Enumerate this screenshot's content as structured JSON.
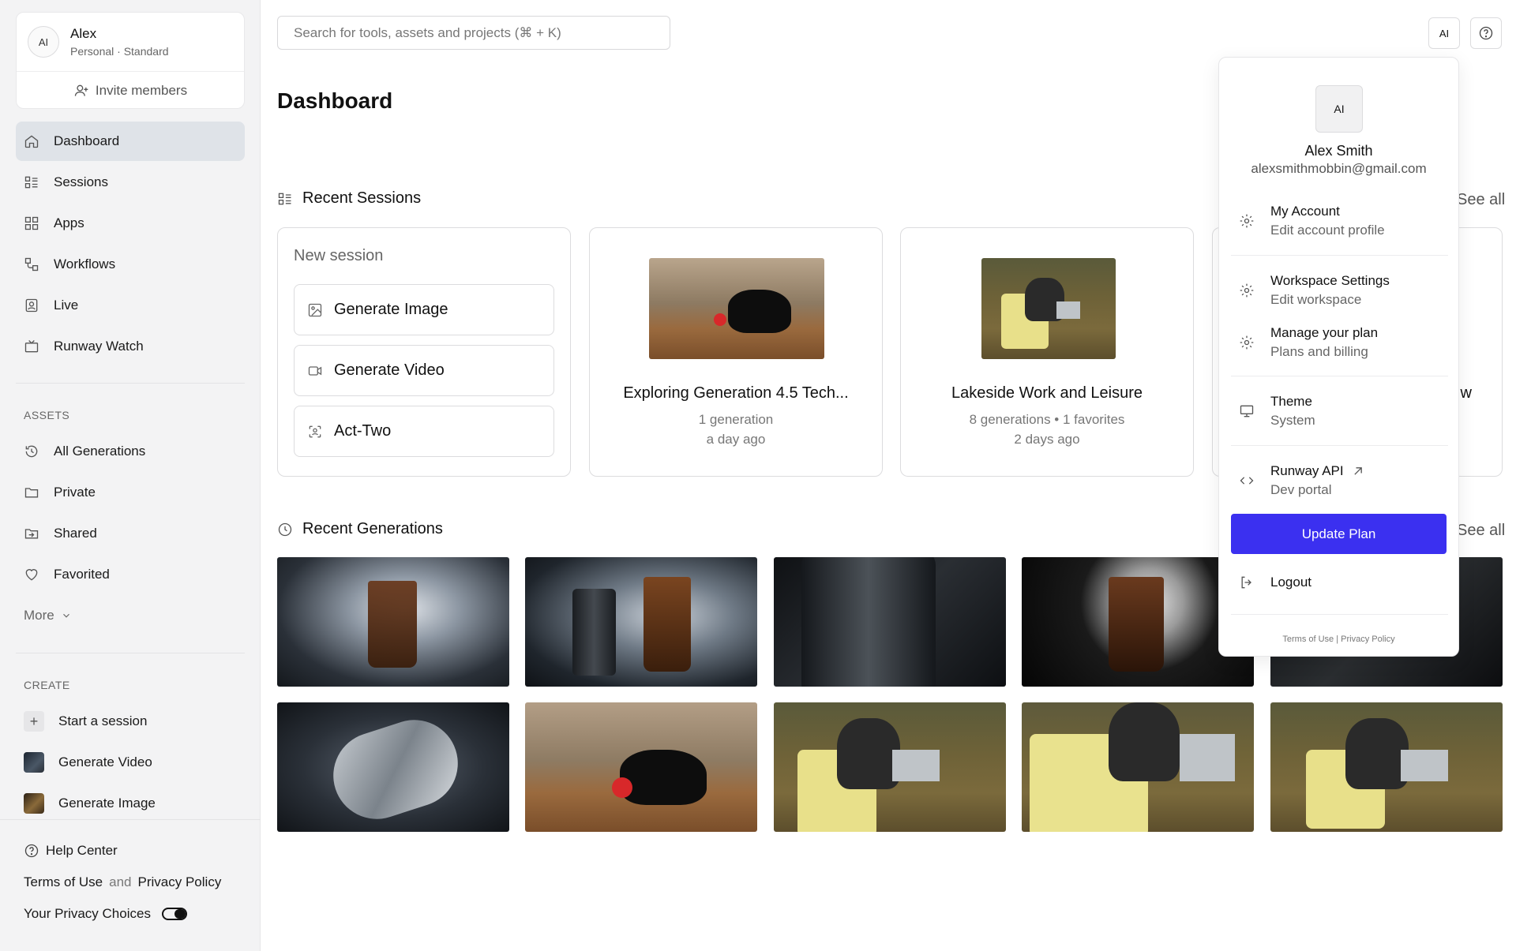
{
  "account": {
    "avatar": "AI",
    "name": "Alex",
    "plan": "Personal · Standard",
    "invite_label": "Invite members"
  },
  "nav": {
    "items": [
      {
        "label": "Dashboard",
        "icon": "home-icon"
      },
      {
        "label": "Sessions",
        "icon": "sessions-icon"
      },
      {
        "label": "Apps",
        "icon": "apps-grid-icon"
      },
      {
        "label": "Workflows",
        "icon": "workflows-icon"
      },
      {
        "label": "Live",
        "icon": "live-icon"
      },
      {
        "label": "Runway Watch",
        "icon": "tv-icon"
      }
    ]
  },
  "assets": {
    "label": "ASSETS",
    "items": [
      {
        "label": "All Generations",
        "icon": "history-icon"
      },
      {
        "label": "Private",
        "icon": "folder-icon"
      },
      {
        "label": "Shared",
        "icon": "shared-folder-icon"
      },
      {
        "label": "Favorited",
        "icon": "heart-icon"
      }
    ],
    "more_label": "More"
  },
  "create": {
    "label": "CREATE",
    "items": [
      {
        "label": "Start a session"
      },
      {
        "label": "Generate Video"
      },
      {
        "label": "Generate Image"
      }
    ]
  },
  "footer": {
    "help": "Help Center",
    "terms": "Terms of Use",
    "and": "and",
    "privacy": "Privacy Policy",
    "choices": "Your Privacy Choices"
  },
  "search": {
    "placeholder": "Search for tools, assets and projects (⌘ + K)"
  },
  "topbar": {
    "avatar": "AI"
  },
  "page_title": "Dashboard",
  "recent_sessions": {
    "title": "Recent Sessions",
    "see_all": "See all",
    "new_session": {
      "title": "New session",
      "buttons": [
        "Generate Image",
        "Generate Video",
        "Act-Two"
      ]
    },
    "sessions": [
      {
        "title": "Exploring Generation 4.5 Tech...",
        "line1": "1 generation",
        "line2": "a day ago"
      },
      {
        "title": "Lakeside Work and Leisure",
        "line1": "8 generations • 1 favorites",
        "line2": "2 days ago"
      }
    ],
    "partial_card_text": "w"
  },
  "recent_generations": {
    "title": "Recent Generations",
    "see_all": "See all"
  },
  "menu": {
    "avatar": "AI",
    "name": "Alex Smith",
    "email": "alexsmithmobbin@gmail.com",
    "items": [
      {
        "title": "My Account",
        "sub": "Edit account profile"
      },
      {
        "title": "Workspace Settings",
        "sub": "Edit workspace"
      },
      {
        "title": "Manage your plan",
        "sub": "Plans and billing"
      },
      {
        "title": "Theme",
        "sub": "System"
      },
      {
        "title": "Runway API",
        "sub": "Dev portal"
      }
    ],
    "update_plan": "Update Plan",
    "logout": "Logout",
    "terms": "Terms of Use | Privacy Policy"
  },
  "colors": {
    "accent": "#3b30f0",
    "active_nav": "#dfe3e8",
    "sidebar_bg": "#f3f3f4"
  }
}
